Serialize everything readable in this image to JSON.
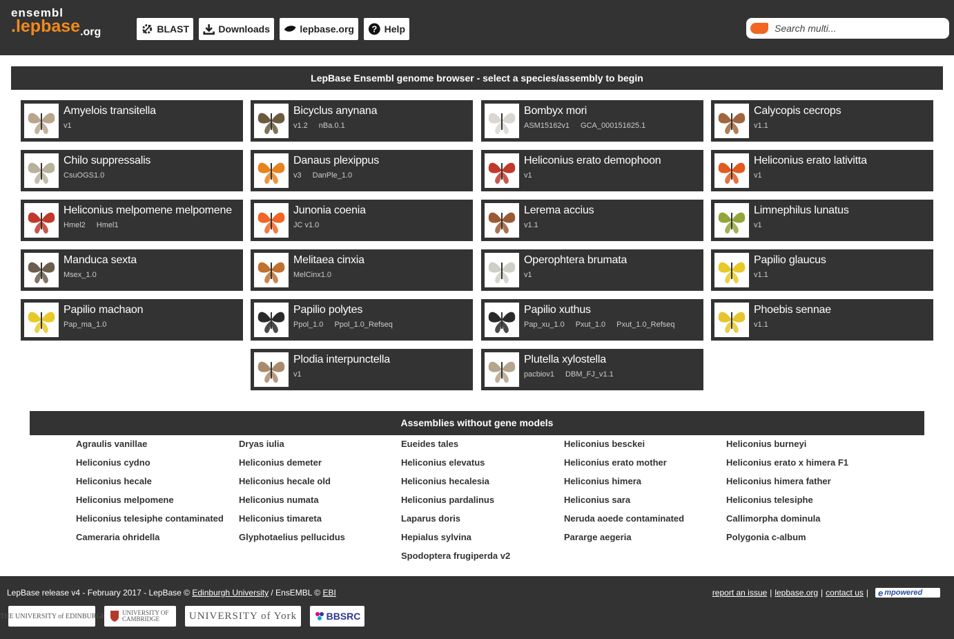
{
  "header": {
    "logo_top": "ensembl",
    "logo_main": ".lepbase",
    "logo_suffix": ".org",
    "buttons": [
      {
        "label": "BLAST",
        "icon": "blast-tools-icon"
      },
      {
        "label": "Downloads",
        "icon": "download-icon"
      },
      {
        "label": "lepbase.org",
        "icon": "lepbase-leaf-icon"
      },
      {
        "label": "Help",
        "icon": "help-circle-icon"
      }
    ],
    "search_placeholder": "Search multi..."
  },
  "banner_title": "LepBase Ensembl genome browser - select a species/assembly to begin",
  "species": [
    {
      "name": "Amyelois transitella",
      "assemblies": [
        "v1"
      ]
    },
    {
      "name": "Bicyclus anynana",
      "assemblies": [
        "v1.2",
        "nBa.0.1"
      ]
    },
    {
      "name": "Bombyx mori",
      "assemblies": [
        "ASM15162v1",
        "GCA_000151625.1"
      ]
    },
    {
      "name": "Calycopis cecrops",
      "assemblies": [
        "v1.1"
      ]
    },
    {
      "name": "Chilo suppressalis",
      "assemblies": [
        "CsuOGS1.0"
      ]
    },
    {
      "name": "Danaus plexippus",
      "assemblies": [
        "v3",
        "DanPle_1.0"
      ]
    },
    {
      "name": "Heliconius erato demophoon",
      "assemblies": [
        "v1"
      ]
    },
    {
      "name": "Heliconius erato lativitta",
      "assemblies": [
        "v1"
      ]
    },
    {
      "name": "Heliconius melpomene melpomene",
      "assemblies": [
        "Hmel2",
        "Hmel1"
      ]
    },
    {
      "name": "Junonia coenia",
      "assemblies": [
        "JC v1.0"
      ]
    },
    {
      "name": "Lerema accius",
      "assemblies": [
        "v1.1"
      ]
    },
    {
      "name": "Limnephilus lunatus",
      "assemblies": [
        "v1"
      ]
    },
    {
      "name": "Manduca sexta",
      "assemblies": [
        "Msex_1.0"
      ]
    },
    {
      "name": "Melitaea cinxia",
      "assemblies": [
        "MelCinx1.0"
      ]
    },
    {
      "name": "Operophtera brumata",
      "assemblies": [
        "v1"
      ]
    },
    {
      "name": "Papilio glaucus",
      "assemblies": [
        "v1.1"
      ]
    },
    {
      "name": "Papilio machaon",
      "assemblies": [
        "Pap_ma_1.0"
      ]
    },
    {
      "name": "Papilio polytes",
      "assemblies": [
        "Ppol_1.0",
        "Ppol_1.0_Refseq"
      ]
    },
    {
      "name": "Papilio xuthus",
      "assemblies": [
        "Pap_xu_1.0",
        "Pxut_1.0",
        "Pxut_1.0_Refseq"
      ]
    },
    {
      "name": "Phoebis sennae",
      "assemblies": [
        "v1.1"
      ]
    },
    {
      "name": "Plodia interpunctella",
      "assemblies": [
        "v1"
      ]
    },
    {
      "name": "Plutella xylostella",
      "assemblies": [
        "pacbiov1",
        "DBM_FJ_v1.1"
      ]
    }
  ],
  "no_gene_models_title": "Assemblies without gene models",
  "no_gene_models": [
    [
      "Agraulis vanillae",
      "Heliconius cydno",
      "Heliconius hecale",
      "Heliconius melpomene",
      "Heliconius telesiphe contaminated",
      "Cameraria ohridella"
    ],
    [
      "Dryas iulia",
      "Heliconius demeter",
      "Heliconius hecale old",
      "Heliconius numata",
      "Heliconius timareta",
      "Glyphotaelius pellucidus"
    ],
    [
      "Eueides tales",
      "Heliconius elevatus",
      "Heliconius hecalesia",
      "Heliconius pardalinus",
      "Laparus doris",
      "Hepialus sylvina",
      "Spodoptera frugiperda v2"
    ],
    [
      "Heliconius besckei",
      "Heliconius erato mother",
      "Heliconius himera",
      "Heliconius sara",
      "Neruda aoede contaminated",
      "Pararge aegeria"
    ],
    [
      "Heliconius burneyi",
      "Heliconius erato x himera F1",
      "Heliconius himera father",
      "Heliconius telesiphe",
      "Callimorpha dominula",
      "Polygonia c-album"
    ]
  ],
  "footer": {
    "release_text": "LepBase release v4 - February 2017 - LepBase © ",
    "edinburgh_link": "Edinburgh University",
    "ensembl_text": " / EnsEMBL © ",
    "ebi_link": "EBI",
    "links": [
      "report an issue",
      "lepbase.org",
      "contact us"
    ],
    "empowered": "mpowered",
    "empowered_e": "e",
    "partners": [
      "THE UNIVERSITY of EDINBURGH",
      "UNIVERSITY OF CAMBRIDGE",
      "UNIVERSITY of York",
      "BBSRC"
    ]
  },
  "colors": {
    "header_bg": "#333333",
    "accent": "#f28a1c",
    "card_bg": "#333333"
  }
}
